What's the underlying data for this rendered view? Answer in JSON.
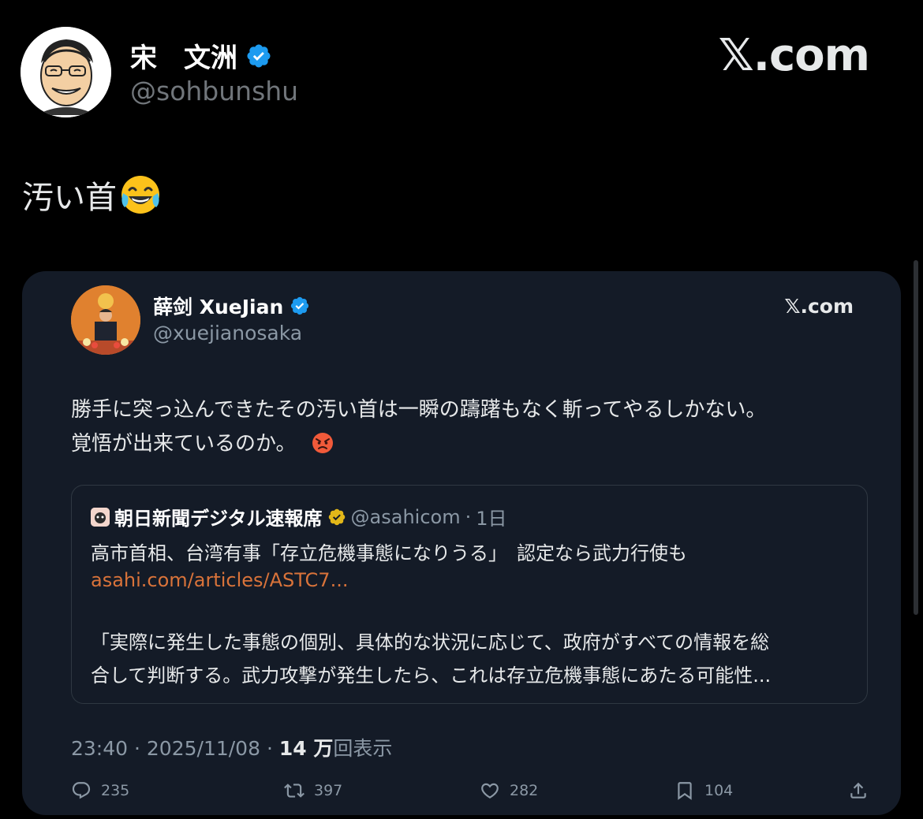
{
  "outer_post": {
    "display_name": "宋　文洲",
    "handle": "@sohbunshu",
    "brand": "𝕏.com",
    "text": "汚い首",
    "emoji": "face-with-tears-of-joy"
  },
  "quoted_post": {
    "display_name": "薛剑 XueJian",
    "handle": "@xuejianosaka",
    "brand": "𝕏.com",
    "body_line1": "勝手に突っ込んできたその汚い首は一瞬の躊躇もなく斬ってやるしかない。",
    "body_line2": "覚悟が出来ているのか。",
    "emoji": "angry-face",
    "nested": {
      "name": "朝日新聞デジタル速報席",
      "handle": "@asahicom",
      "time": "1日",
      "title": "高市首相、台湾有事「存立危機事態になりうる」　認定なら武力行使も",
      "link": "asahi.com/articles/ASTC7...",
      "quote_line1": "「実際に発生した事態の個別、具体的な状況に応じて、政府がすべての情報を総",
      "quote_line2": "合して判断する。武力攻撃が発生したら、これは存立危機事態にあたる可能性..."
    },
    "meta": {
      "time": "23:40",
      "date": "2025/11/08",
      "views_count": "14 万",
      "views_label": "回表示"
    },
    "actions": {
      "replies": "235",
      "reposts": "397",
      "likes": "282",
      "bookmarks": "104"
    }
  },
  "colors": {
    "background": "#000000",
    "card": "#141b27",
    "verified": "#1d9bf0",
    "gold_badge": "#e2b719",
    "link": "#d9733a",
    "muted": "#8b98a5"
  }
}
